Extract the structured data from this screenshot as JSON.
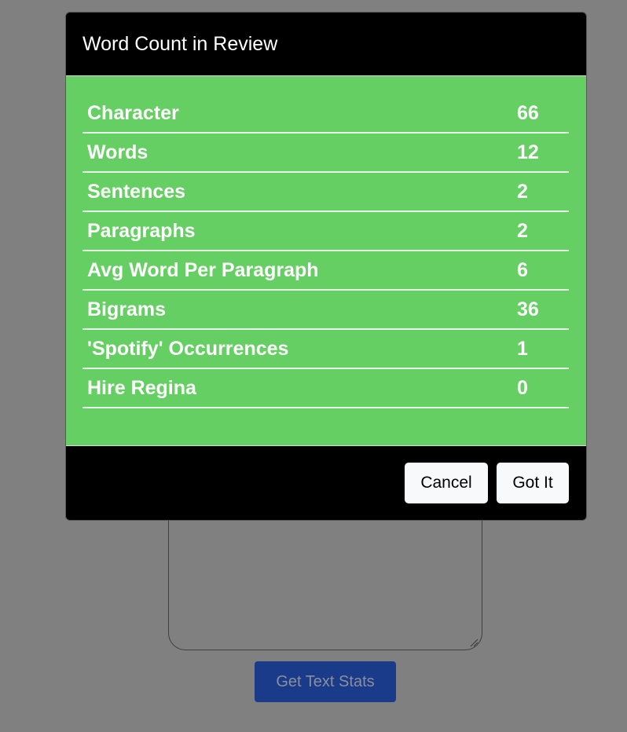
{
  "modal": {
    "title": "Word Count in Review",
    "stats": [
      {
        "label": "Character",
        "value": "66"
      },
      {
        "label": "Words",
        "value": "12"
      },
      {
        "label": "Sentences",
        "value": "2"
      },
      {
        "label": "Paragraphs",
        "value": "2"
      },
      {
        "label": "Avg Word Per Paragraph",
        "value": "6"
      },
      {
        "label": "Bigrams",
        "value": "36"
      },
      {
        "label": "'Spotify' Occurrences",
        "value": "1"
      },
      {
        "label": "Hire Regina",
        "value": "0"
      }
    ],
    "cancel_label": "Cancel",
    "confirm_label": "Got It"
  },
  "page": {
    "stats_button_label": "Get Text Stats"
  },
  "colors": {
    "overlay": "#808080",
    "modal_body": "#66cf63",
    "modal_header": "#000000",
    "stats_button": "#1a3a8a"
  }
}
